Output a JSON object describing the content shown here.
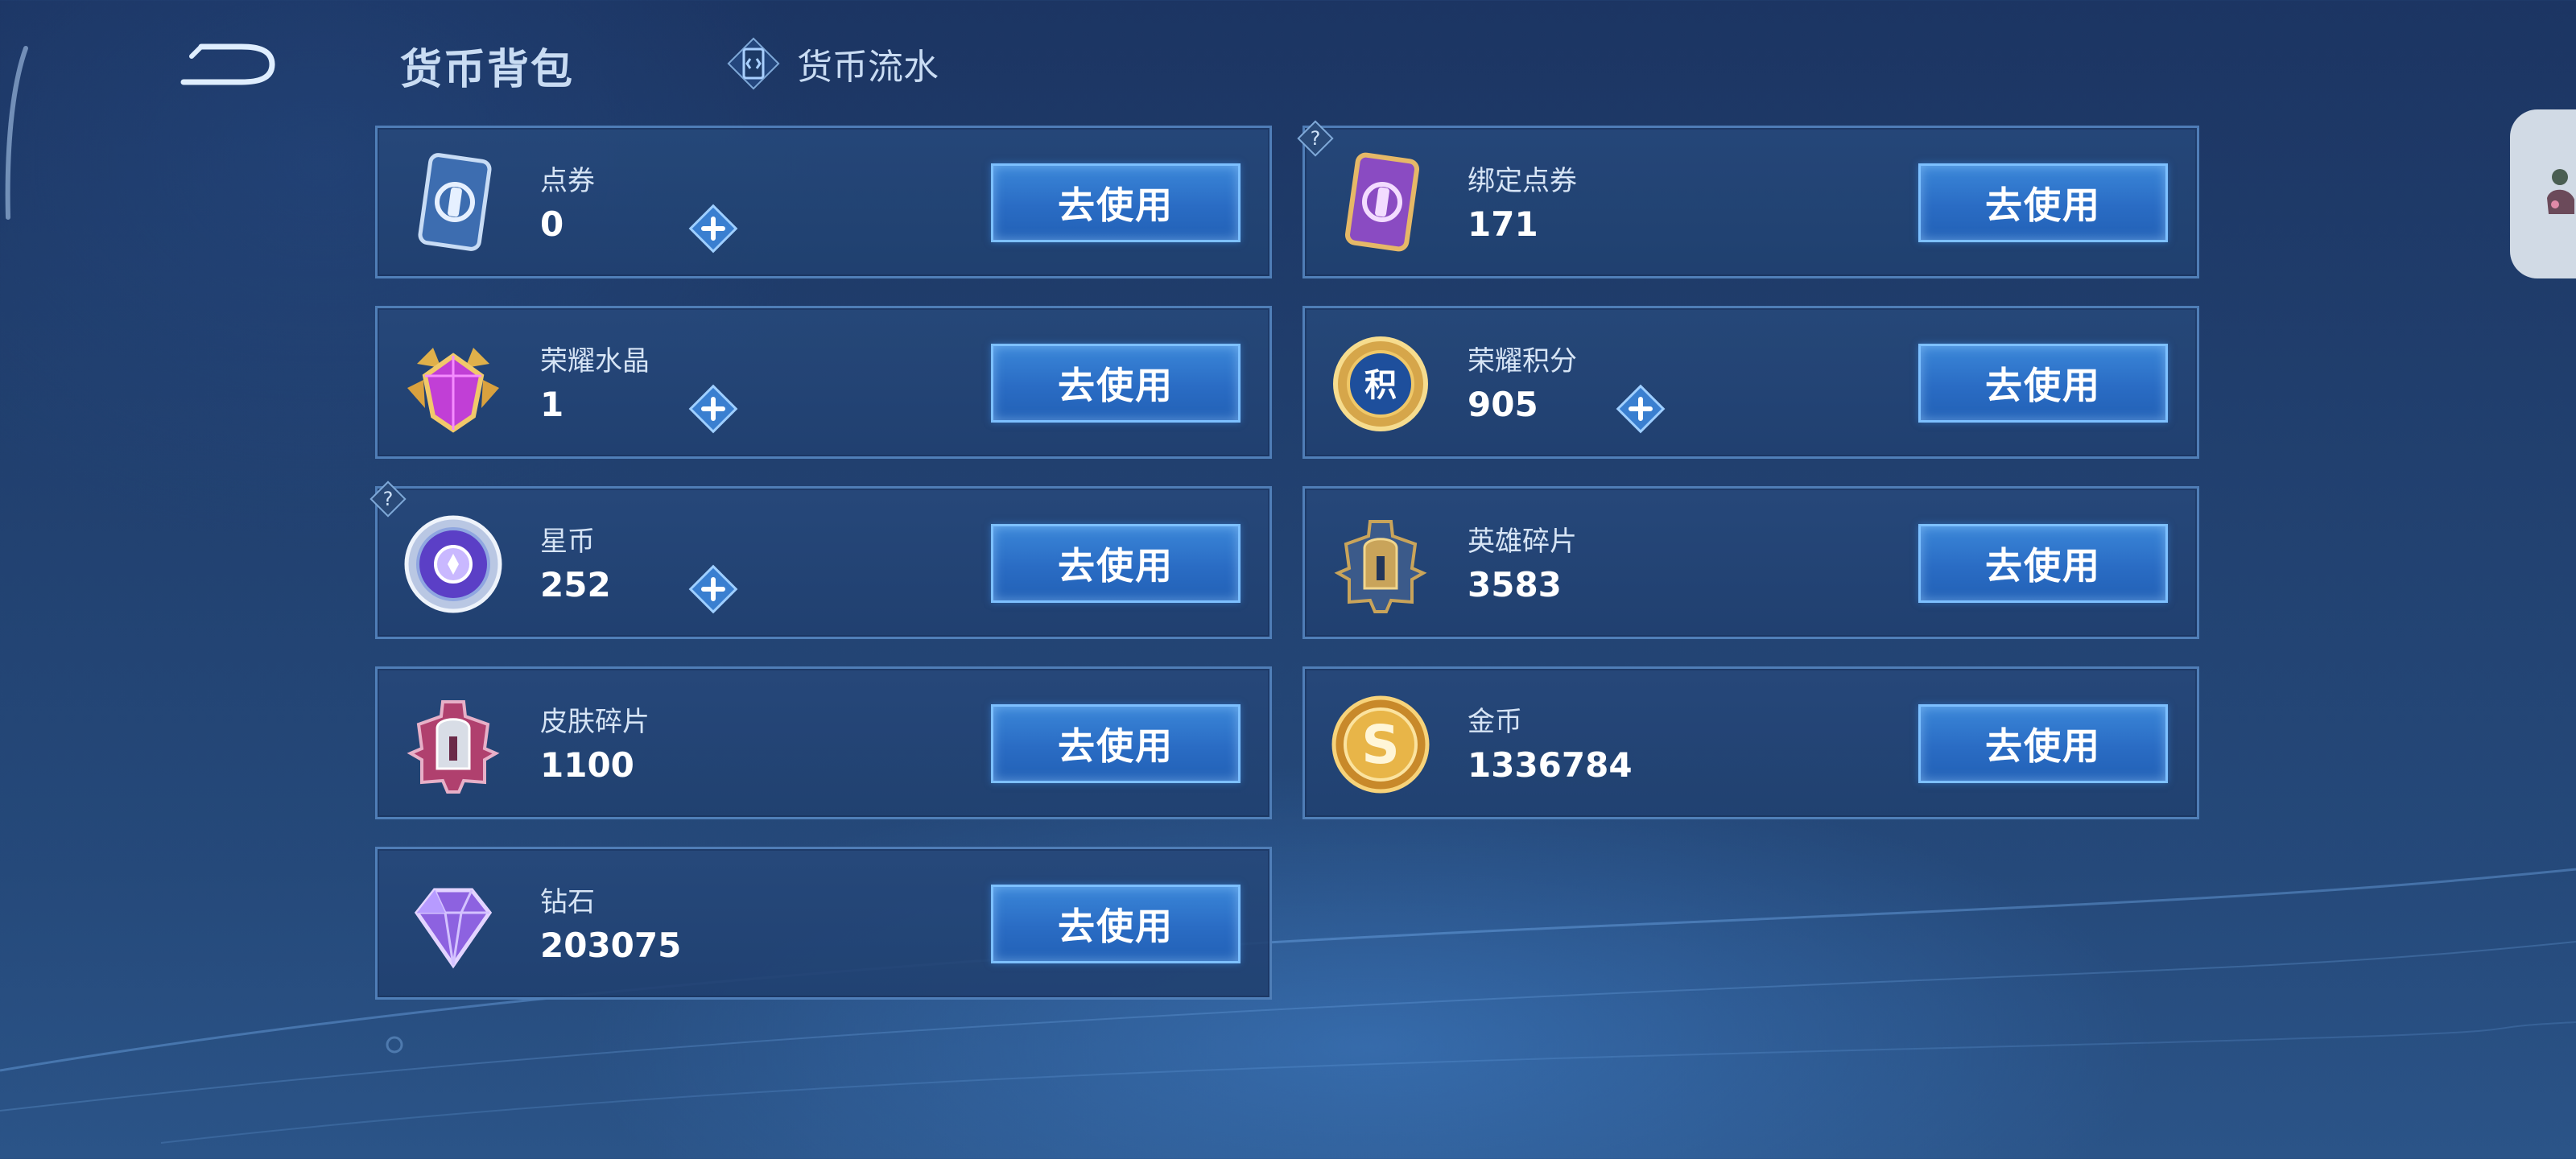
{
  "header": {
    "title": "货币背包",
    "tab_label": "货币流水"
  },
  "use_label": "去使用",
  "currencies": [
    {
      "name": "点券",
      "value": "0",
      "icon": "blue-card-icon",
      "has_plus": true,
      "has_help": false
    },
    {
      "name": "绑定点券",
      "value": "171",
      "icon": "purple-card-icon",
      "has_plus": false,
      "has_help": true
    },
    {
      "name": "荣耀水晶",
      "value": "1",
      "icon": "glory-crystal-icon",
      "has_plus": true,
      "has_help": false
    },
    {
      "name": "荣耀积分",
      "value": "905",
      "icon": "glory-points-icon",
      "has_plus": true,
      "has_help": false
    },
    {
      "name": "星币",
      "value": "252",
      "icon": "star-coin-icon",
      "has_plus": true,
      "has_help": true
    },
    {
      "name": "英雄碎片",
      "value": "3583",
      "icon": "hero-fragment-icon",
      "has_plus": false,
      "has_help": false
    },
    {
      "name": "皮肤碎片",
      "value": "1100",
      "icon": "skin-fragment-icon",
      "has_plus": false,
      "has_help": false
    },
    {
      "name": "金币",
      "value": "1336784",
      "icon": "gold-coin-icon",
      "has_plus": false,
      "has_help": false
    },
    {
      "name": "钻石",
      "value": "203075",
      "icon": "diamond-icon",
      "has_plus": false,
      "has_help": false
    }
  ],
  "colors": {
    "background": "#21406f",
    "card_border": "#5f91cd",
    "button": "#2a6cc4",
    "button_border": "#7dc0ff"
  }
}
